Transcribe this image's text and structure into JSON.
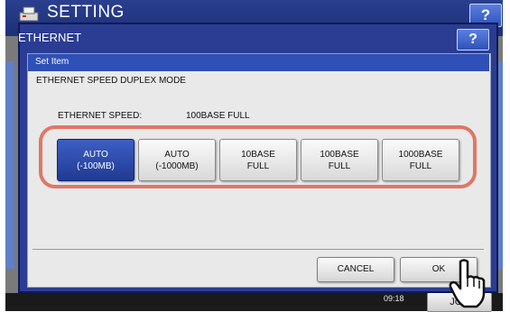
{
  "background": {
    "title": "SETTING",
    "help_label": "?",
    "time": "09:18",
    "job_label": "JOB"
  },
  "dialog": {
    "title": "ETHERNET",
    "help_label": "?",
    "strip_label": "Set Item",
    "setting_title": "ETHERNET SPEED DUPLEX MODE",
    "speed_label": "ETHERNET SPEED:",
    "speed_value": "100BASE FULL",
    "options": [
      {
        "label": "AUTO\n(-100MB)",
        "selected": true
      },
      {
        "label": "AUTO\n(-1000MB)",
        "selected": false
      },
      {
        "label": "10BASE\nFULL",
        "selected": false
      },
      {
        "label": "100BASE\nFULL",
        "selected": false
      },
      {
        "label": "1000BASE\nFULL",
        "selected": false
      }
    ],
    "cancel_label": "CANCEL",
    "ok_label": "OK"
  },
  "colors": {
    "dialog_frame": "#2b3d92",
    "selected_option": "#2a4aae",
    "highlight_ring": "#e07766",
    "panel_bg": "#e9e9ea"
  },
  "icons": [
    "printer-icon",
    "hand-pointer-icon"
  ]
}
